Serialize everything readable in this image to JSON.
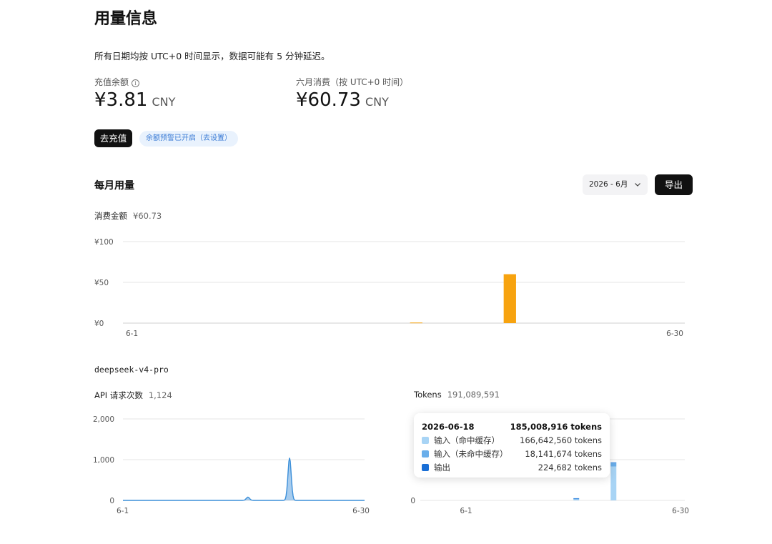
{
  "page": {
    "title": "用量信息",
    "note": "所有日期均按 UTC+0 时间显示，数据可能有 5 分钟延迟。"
  },
  "balance": {
    "label": "充值余额",
    "value": "¥3.81",
    "unit": "CNY",
    "recharge_label": "去充值",
    "alert_label": "余额预警已开启（去设置）"
  },
  "monthly_spend": {
    "label": "六月消费（按 UTC+0 时间）",
    "value": "¥60.73",
    "unit": "CNY"
  },
  "usage": {
    "section_title": "每月用量",
    "month_value": "2026 - 6月",
    "export_label": "导出"
  },
  "icons": {
    "info": "info-icon",
    "chevron": "chevron-down-icon"
  },
  "colors": {
    "spend_bar": "#f7a30f",
    "requests_line": "#3b8fd9",
    "tokens_cache_hit": "#a8d4f5",
    "tokens_cache_miss": "#6aaeea",
    "tokens_output": "#1a6fd6"
  },
  "chart_data": [
    {
      "type": "bar",
      "title": "消费金额",
      "total": "¥60.73",
      "x_first": "6-1",
      "x_last": "6-30",
      "yticks": [
        "¥0",
        "¥50",
        "¥100"
      ],
      "ylim": [
        0,
        100
      ],
      "grid": true,
      "days": [
        1,
        2,
        3,
        4,
        5,
        6,
        7,
        8,
        9,
        10,
        11,
        12,
        13,
        14,
        15,
        16,
        17,
        18,
        19,
        20,
        21,
        22,
        23,
        24,
        25,
        26,
        27,
        28,
        29,
        30
      ],
      "values": [
        0,
        0,
        0,
        0,
        0,
        0,
        0,
        0,
        0,
        0,
        0,
        0,
        0,
        0,
        0,
        0.7,
        0,
        0,
        0,
        0,
        60.03,
        0,
        0,
        0,
        0,
        0,
        0,
        0,
        0,
        0
      ]
    },
    {
      "model": "deepseek-v4-pro",
      "type": "area",
      "title": "API 请求次数",
      "total": "1,124",
      "x_first": "6-1",
      "x_last": "6-30",
      "yticks": [
        "0",
        "1,000",
        "2,000"
      ],
      "ylim": [
        0,
        2000
      ],
      "grid": true,
      "days": [
        1,
        2,
        3,
        4,
        5,
        6,
        7,
        8,
        9,
        10,
        11,
        12,
        13,
        14,
        15,
        16,
        17,
        18,
        19,
        20,
        21,
        22,
        23,
        24,
        25,
        26,
        27,
        28,
        29,
        30
      ],
      "values": [
        0,
        0,
        0,
        0,
        0,
        0,
        0,
        0,
        0,
        0,
        0,
        0,
        0,
        0,
        0,
        80,
        0,
        0,
        0,
        0,
        1044,
        0,
        0,
        0,
        0,
        0,
        0,
        0,
        0,
        0
      ]
    },
    {
      "type": "bar",
      "stacked": true,
      "title": "Tokens",
      "total": "191,089,591",
      "x_first": "6-1",
      "x_last": "6-30",
      "yticks": [
        "0"
      ],
      "grid": true,
      "days": [
        16,
        21
      ],
      "series": [
        {
          "name": "输入（命中缓存）",
          "values": [
            5200000,
            166642560
          ]
        },
        {
          "name": "输入（未命中缓存）",
          "values": [
            760000,
            18141674
          ]
        },
        {
          "name": "输出",
          "values": [
            20000,
            224682
          ]
        }
      ],
      "tooltip": {
        "date": "2026-06-18",
        "total": "185,008,916 tokens",
        "rows": [
          {
            "name": "输入（命中缓存）",
            "value": "166,642,560 tokens"
          },
          {
            "name": "输入（未命中缓存）",
            "value": "18,141,674 tokens"
          },
          {
            "name": "输出",
            "value": "224,682 tokens"
          }
        ]
      }
    }
  ]
}
